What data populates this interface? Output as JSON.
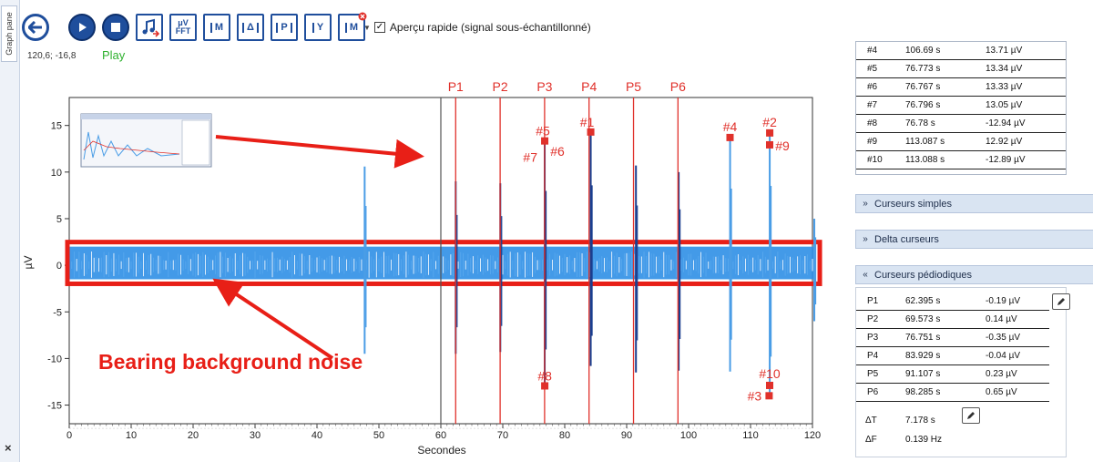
{
  "side_tab": {
    "label": "Graph pane",
    "close": "×"
  },
  "toolbar": {
    "buttons": [
      {
        "name": "back",
        "glyph": ""
      },
      {
        "name": "play",
        "glyph": ""
      },
      {
        "name": "stop",
        "glyph": ""
      },
      {
        "name": "export-audio",
        "glyph": ""
      },
      {
        "name": "fft",
        "glyph": "μV FFT"
      },
      {
        "name": "marker-m",
        "glyph": "M"
      },
      {
        "name": "delta-cursor",
        "glyph": "Δ"
      },
      {
        "name": "periodic-cursor",
        "glyph": "P"
      },
      {
        "name": "y-cursor",
        "glyph": "Y"
      },
      {
        "name": "remove-marker",
        "glyph": "M"
      }
    ],
    "checkbox_checked": "✓",
    "apercu_label": "Aperçu rapide (signal sous-échantillonné)"
  },
  "coords_readout": "120,6; -16,8",
  "play_status": "Play",
  "chart_data": {
    "type": "line",
    "xlabel": "Secondes",
    "ylabel": "µV",
    "xlim": [
      0,
      120
    ],
    "ylim": [
      -17,
      18
    ],
    "xticks": [
      "0",
      "10",
      "20",
      "30",
      "40",
      "50",
      "60",
      "70",
      "80",
      "90",
      "100",
      "110",
      "120"
    ],
    "yticks": [
      "15",
      "10",
      "5",
      "0",
      "-5",
      "-10",
      "-15"
    ],
    "grid": true,
    "periodic_cursors": [
      {
        "label": "P1",
        "x": 62.395
      },
      {
        "label": "P2",
        "x": 69.573
      },
      {
        "label": "P3",
        "x": 76.751
      },
      {
        "label": "P4",
        "x": 83.929
      },
      {
        "label": "P5",
        "x": 91.107
      },
      {
        "label": "P6",
        "x": 98.285
      }
    ],
    "cursor_line_x": 60,
    "peaks": [
      {
        "label": "#1",
        "x": 84.2,
        "y": 14.3
      },
      {
        "label": "#2",
        "x": 113.1,
        "y": 14.2
      },
      {
        "label": "#3",
        "x": 113.0,
        "y": -14.0
      },
      {
        "label": "#4",
        "x": 106.69,
        "y": 13.71
      },
      {
        "label": "#5",
        "x": 76.773,
        "y": 13.34
      },
      {
        "label": "#6",
        "x": 76.767,
        "y": 13.33
      },
      {
        "label": "#7",
        "x": 76.796,
        "y": 13.05
      },
      {
        "label": "#8",
        "x": 76.78,
        "y": -12.94
      },
      {
        "label": "#9",
        "x": 113.087,
        "y": 12.92
      },
      {
        "label": "#10",
        "x": 113.088,
        "y": -12.89
      }
    ],
    "spikes": [
      {
        "x": 47.7,
        "pos": 10.6,
        "neg": -9.5,
        "color": "#4a9de6"
      },
      {
        "x": 62.4,
        "pos": 9.0,
        "neg": -9.5,
        "color": "#1b3f8f"
      },
      {
        "x": 69.6,
        "pos": 8.8,
        "neg": -9.3,
        "color": "#1b3f8f"
      },
      {
        "x": 76.77,
        "pos": 13.3,
        "neg": -12.9,
        "color": "#1b3f8f"
      },
      {
        "x": 84.2,
        "pos": 14.3,
        "neg": -10.8,
        "color": "#1b3f8f"
      },
      {
        "x": 91.5,
        "pos": 10.7,
        "neg": -11.5,
        "color": "#1b3f8f"
      },
      {
        "x": 98.4,
        "pos": 10.0,
        "neg": -11.3,
        "color": "#1b3f8f"
      },
      {
        "x": 106.7,
        "pos": 13.7,
        "neg": -11.4,
        "color": "#4a9de6"
      },
      {
        "x": 113.1,
        "pos": 14.2,
        "neg": -14.0,
        "color": "#4a9de6"
      },
      {
        "x": 120.3,
        "pos": 5.0,
        "neg": -6.0,
        "color": "#4a9de6"
      }
    ],
    "noise_band": [
      -1.5,
      2.0
    ],
    "annotation": "Bearing background noise"
  },
  "peaks_table": [
    {
      "id": "#4",
      "time": "106.69 s",
      "value": "13.71 µV"
    },
    {
      "id": "#5",
      "time": "76.773 s",
      "value": "13.34 µV"
    },
    {
      "id": "#6",
      "time": "76.767 s",
      "value": "13.33 µV"
    },
    {
      "id": "#7",
      "time": "76.796 s",
      "value": "13.05 µV"
    },
    {
      "id": "#8",
      "time": "76.78 s",
      "value": "-12.94 µV"
    },
    {
      "id": "#9",
      "time": "113.087 s",
      "value": "12.92 µV"
    },
    {
      "id": "#10",
      "time": "113.088 s",
      "value": "-12.89 µV"
    }
  ],
  "sections": {
    "simple": "Curseurs simples",
    "delta": "Delta curseurs",
    "periodic": "Curseurs pédiodiques",
    "collapsed_chevron": "»",
    "expanded_chevron": "«"
  },
  "periodic_table": [
    {
      "id": "P1",
      "time": "62.395 s",
      "value": "-0.19 µV"
    },
    {
      "id": "P2",
      "time": "69.573 s",
      "value": "0.14 µV"
    },
    {
      "id": "P3",
      "time": "76.751 s",
      "value": "-0.35 µV"
    },
    {
      "id": "P4",
      "time": "83.929 s",
      "value": "-0.04 µV"
    },
    {
      "id": "P5",
      "time": "91.107 s",
      "value": "0.23 µV"
    },
    {
      "id": "P6",
      "time": "98.285 s",
      "value": "0.65 µV"
    }
  ],
  "delta": {
    "dt_label": "ΔT",
    "dt_value": "7.178 s",
    "df_label": "ΔF",
    "df_value": "0.139 Hz"
  },
  "colors": {
    "cursor_red": "#e0312b",
    "signal_blue": "#4a9de6",
    "signal_dark": "#1b3f8f",
    "annotation_red": "#e81f17",
    "toolbar_blue": "#1f4e9c"
  }
}
